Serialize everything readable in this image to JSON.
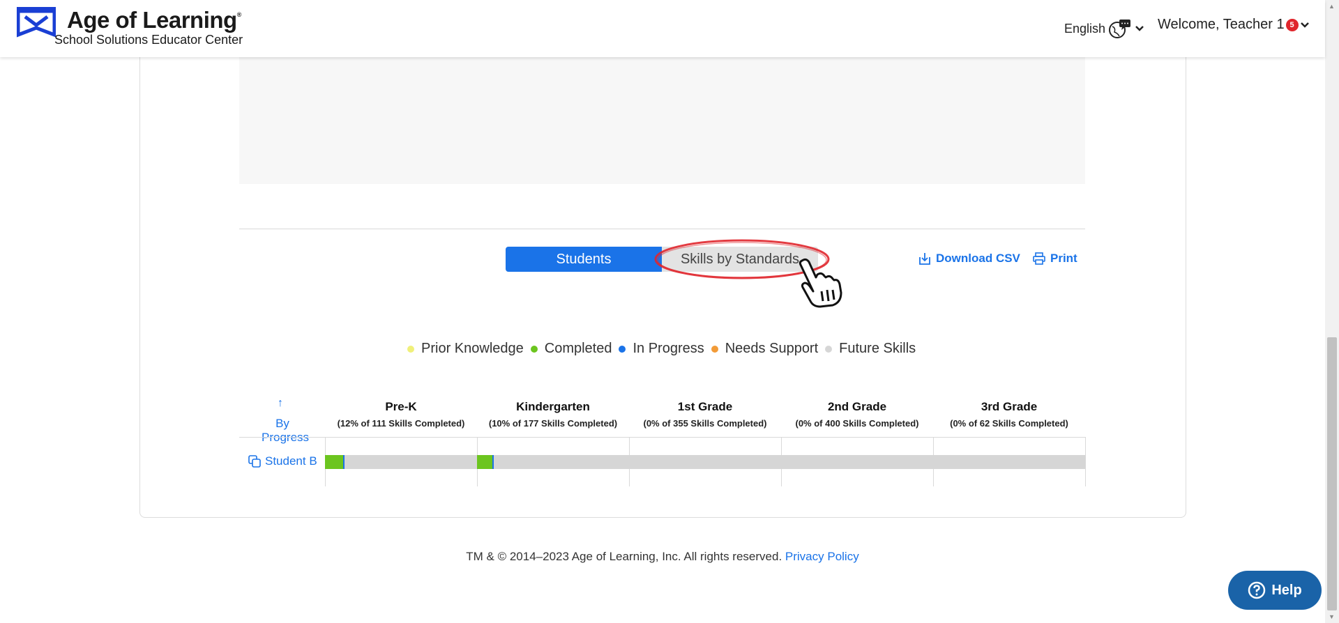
{
  "header": {
    "brand": "Age of Learning",
    "brand_mark": "®",
    "tagline": "School Solutions Educator Center",
    "language": "English",
    "welcome": "Welcome, Teacher 1",
    "notification_count": "5"
  },
  "toolbar": {
    "tabs": [
      {
        "label": "Students",
        "active": true
      },
      {
        "label": "Skills by Standards",
        "active": false
      }
    ],
    "download_label": "Download CSV",
    "print_label": "Print"
  },
  "legend": [
    {
      "label": "Prior Knowledge",
      "color": "#f0f07a"
    },
    {
      "label": "Completed",
      "color": "#6cc51f"
    },
    {
      "label": "In Progress",
      "color": "#1a73e8"
    },
    {
      "label": "Needs Support",
      "color": "#f29b38"
    },
    {
      "label": "Future Skills",
      "color": "#d6d6d6"
    }
  ],
  "grid": {
    "sort_arrow": "↑",
    "sort_label": "By Progress",
    "columns": [
      {
        "title": "Pre-K",
        "subtitle": "(12% of 111 Skills Completed)"
      },
      {
        "title": "Kindergarten",
        "subtitle": "(10% of 177 Skills Completed)"
      },
      {
        "title": "1st Grade",
        "subtitle": "(0% of 355 Skills Completed)"
      },
      {
        "title": "2nd Grade",
        "subtitle": "(0% of 400 Skills Completed)"
      },
      {
        "title": "3rd Grade",
        "subtitle": "(0% of 62 Skills Completed)"
      }
    ],
    "rows": [
      {
        "student": "Student B",
        "progress": [
          {
            "completed": 0.12,
            "in_progress": 0.01
          },
          {
            "completed": 0.1,
            "in_progress": 0.01
          },
          {
            "completed": 0,
            "in_progress": 0
          },
          {
            "completed": 0,
            "in_progress": 0
          },
          {
            "completed": 0,
            "in_progress": 0
          }
        ]
      }
    ]
  },
  "footer": {
    "copyright": "TM & © 2014–2023 Age of Learning, Inc. All rights reserved.",
    "privacy_label": "Privacy Policy"
  },
  "help_label": "Help",
  "colors": {
    "accent": "#1a73e8",
    "completed": "#6cc51f",
    "in_progress": "#1a73e8",
    "future": "#d6d6d6",
    "help_button": "#1a63a8",
    "highlight_ring": "#e0262c"
  }
}
